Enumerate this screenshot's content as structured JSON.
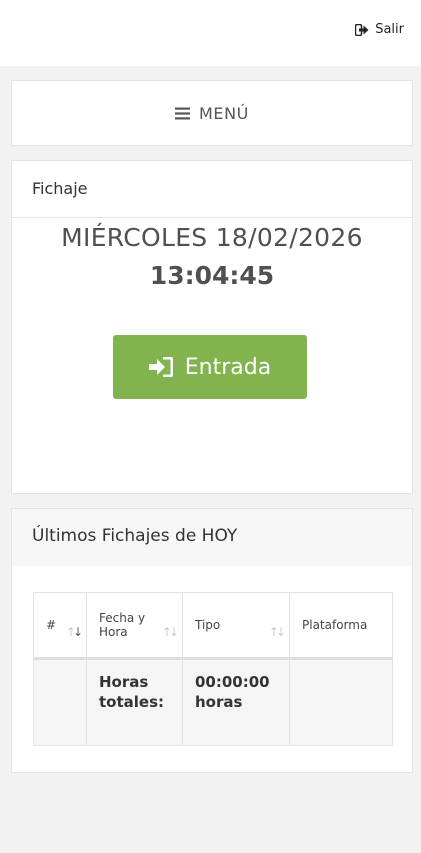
{
  "topbar": {
    "logout_label": "Salir",
    "logout_icon": "sign-out-icon"
  },
  "menu": {
    "label": "MENÚ",
    "icon": "hamburger-icon"
  },
  "fichaje": {
    "title": "Fichaje",
    "date": "MIÉRCOLES 18/02/2026",
    "time": "13:04:45",
    "entrada_label": "Entrada",
    "entrada_icon": "sign-in-icon",
    "entrada_color": "#81b34e"
  },
  "ultimos": {
    "title": "Últimos Fichajes de HOY",
    "columns": [
      "#",
      "Fecha y Hora",
      "Tipo",
      "Plataforma"
    ],
    "summary_row": {
      "label": "Horas totales:",
      "value": "00:00:00 horas"
    }
  }
}
